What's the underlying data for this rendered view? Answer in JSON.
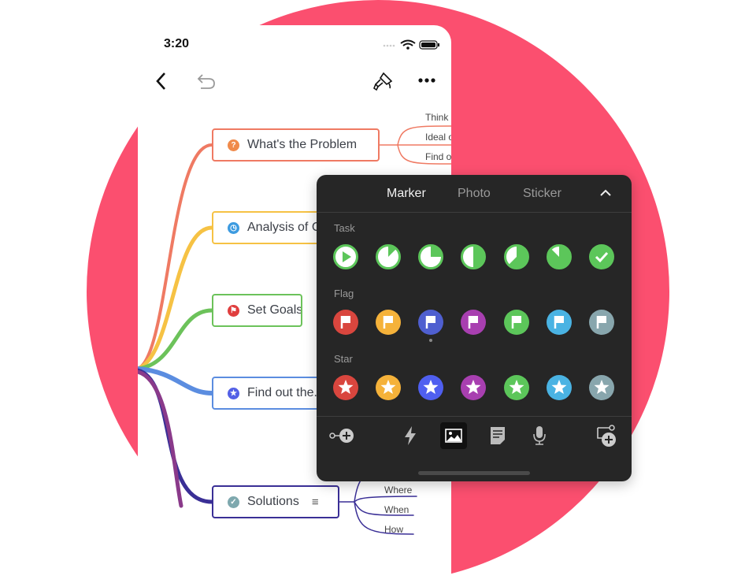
{
  "status_bar": {
    "time": "3:20"
  },
  "toolbar": {
    "icons": [
      "back-icon",
      "undo-icon",
      "format-brush-icon",
      "more-icon"
    ]
  },
  "mindmap": {
    "nodes": [
      {
        "label": "What's the Problem",
        "icon": "question-icon",
        "color": "#ef7a63",
        "children": [
          "Think ...",
          "Ideal o...",
          "Find o..."
        ]
      },
      {
        "label": "Analysis of C...",
        "icon": "clock-icon",
        "color": "#f6c244"
      },
      {
        "label": "Set Goals",
        "icon": "flag-icon",
        "color": "#6cc25a"
      },
      {
        "label": "Find out the...",
        "icon": "star-icon",
        "color": "#5b8de0"
      },
      {
        "label": "Solutions",
        "icon": "check-icon",
        "color": "#3a2f96",
        "children": [
          "Where",
          "When",
          "How"
        ]
      }
    ],
    "extra_branch_color": "#8a3a8a"
  },
  "panel": {
    "tabs": [
      {
        "label": "Marker",
        "active": true
      },
      {
        "label": "Photo",
        "active": false
      },
      {
        "label": "Sticker",
        "active": false
      }
    ],
    "sections": [
      {
        "label": "Task",
        "type": "task",
        "progress": [
          0,
          0.125,
          0.25,
          0.5,
          0.625,
          0.875,
          1
        ]
      },
      {
        "label": "Flag",
        "type": "flag",
        "colors": [
          "#d9463e",
          "#f5b23a",
          "#4f5fd0",
          "#a83fb0",
          "#5cc65a",
          "#4ab3e3",
          "#88a6ad"
        ],
        "selected": 2
      },
      {
        "label": "Star",
        "type": "star",
        "colors": [
          "#d9463e",
          "#f5b23a",
          "#4f5ff0",
          "#a83fb0",
          "#5cc65a",
          "#4ab3e3",
          "#88a6ad"
        ]
      }
    ],
    "tools": [
      "add-relationship-icon",
      "lightning-icon",
      "image-icon",
      "note-icon",
      "microphone-icon",
      "add-subtopic-icon"
    ],
    "active_tool": "image-icon"
  },
  "colors": {
    "background_circle": "#fb4f6f",
    "panel": "#262626",
    "task_green": "#5cc65a"
  }
}
